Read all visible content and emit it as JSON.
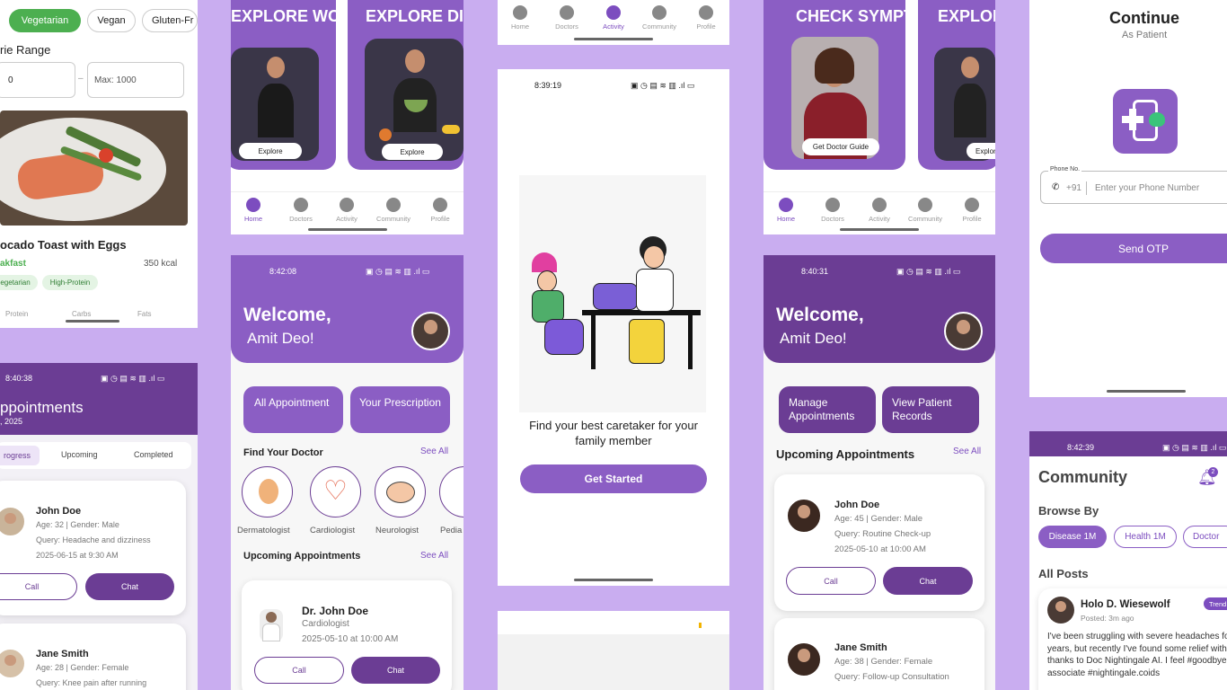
{
  "colors": {
    "background": "#c9adf0",
    "primary": "#8b5ec4",
    "dark": "#6b3d94"
  },
  "s1": {
    "chips": [
      "Vegetarian",
      "Vegan",
      "Gluten-Fr"
    ],
    "range_label": "rie Range",
    "min_value": "0",
    "max_label": "Max:",
    "max_value": "1000",
    "meal_title": "ocado Toast with Eggs",
    "meal_type": "akfast",
    "kcal": "350 kcal",
    "tags": [
      "egetarian",
      "High-Protein"
    ],
    "macros": [
      "Protein",
      "Carbs",
      "Fats"
    ]
  },
  "s2": {
    "time": "8:40:38",
    "title": "ppointments",
    "date": ", 2025",
    "tabs": [
      "rogress",
      "Upcoming",
      "Completed"
    ],
    "patients": [
      {
        "name": "John Doe",
        "meta": "Age: 32 | Gender: Male",
        "query": "Query: Headache and dizziness",
        "when": "2025-06-15 at 9:30 AM"
      },
      {
        "name": "Jane Smith",
        "meta": "Age: 28 | Gender: Female",
        "query": "Query: Knee pain after running"
      }
    ],
    "call": "Call",
    "chat": "Chat"
  },
  "s3": {
    "card1": "EXPLORE WORKOUT",
    "card2": "EXPLORE DIET",
    "explore": "Explore",
    "nav": [
      "Home",
      "Doctors",
      "Activity",
      "Community",
      "Profile"
    ]
  },
  "s4": {
    "time": "8:42:08",
    "welcome": "Welcome,",
    "name": "Amit Deo!",
    "btn1": "All Appointment",
    "btn2": "Your Prescription",
    "find": "Find Your Doctor",
    "see_all": "See All",
    "doctors": [
      "Dermatologist",
      "Cardiologist",
      "Neurologist",
      "Pedia"
    ],
    "upcoming": "Upcoming Appointments",
    "doc_name": "Dr. John Doe",
    "doc_spec": "Cardiologist",
    "doc_when": "2025-05-10 at 10:00 AM",
    "call": "Call",
    "chat": "Chat"
  },
  "s5": {
    "nav": [
      "Home",
      "Doctors",
      "Activity",
      "Community",
      "Profile"
    ]
  },
  "s6": {
    "time": "8:39:19",
    "tagline": "Find your best caretaker for your family member",
    "cta": "Get Started"
  },
  "s8": {
    "card1": "CHECK SYMPTOMS",
    "card2": "EXPLORE WORKOUT",
    "btn1": "Get Doctor Guide",
    "btn2": "Explore",
    "nav": [
      "Home",
      "Doctors",
      "Activity",
      "Community",
      "Profile"
    ]
  },
  "s9": {
    "time": "8:40:31",
    "welcome": "Welcome,",
    "name": "Amit Deo!",
    "btn1": "Manage Appointments",
    "btn2": "View Patient Records",
    "upcoming": "Upcoming Appointments",
    "see_all": "See All",
    "patients": [
      {
        "name": "John Doe",
        "meta": "Age: 45 | Gender: Male",
        "query": "Query: Routine Check-up",
        "when": "2025-05-10 at 10:00 AM"
      },
      {
        "name": "Jane Smith",
        "meta": "Age: 38 | Gender: Female",
        "query": "Query: Follow-up Consultation"
      }
    ],
    "call": "Call",
    "chat": "Chat"
  },
  "s10": {
    "title": "Continue",
    "subtitle": "As Patient",
    "phone_label": "Phone No.",
    "code": "+91",
    "placeholder": "Enter your Phone Number",
    "cta": "Send OTP"
  },
  "s11": {
    "time": "8:42:39",
    "title": "Community",
    "badge": "2",
    "browse": "Browse By",
    "chips": [
      "Disease 1M",
      "Health 1M",
      "Doctor"
    ],
    "all_posts": "All Posts",
    "author": "Holo D. Wiesewolf",
    "posted": "Posted: 3m ago",
    "tag": "Trend",
    "post": "I've been struggling with severe headaches for years, but recently I've found some relief with thanks to Doc Nightingale AI. I feel #goodbye associate #nightingale.coids"
  }
}
